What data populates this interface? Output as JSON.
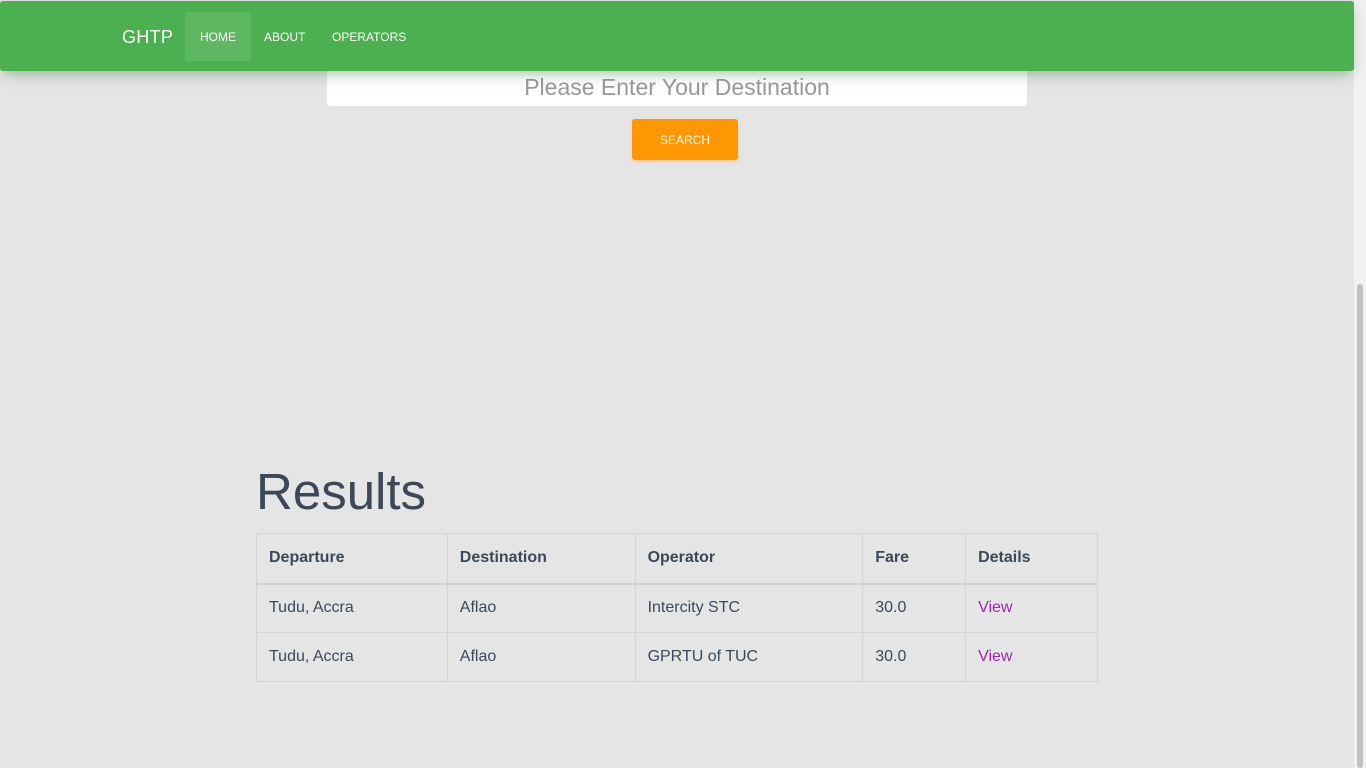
{
  "navbar": {
    "brand": "GHTP",
    "items": [
      {
        "label": "HOME",
        "active": true
      },
      {
        "label": "ABOUT",
        "active": false
      },
      {
        "label": "OPERATORS",
        "active": false
      }
    ]
  },
  "search": {
    "placeholder": "Please Enter Your Destination",
    "value": "",
    "button_label": "SEARCH"
  },
  "results": {
    "title": "Results",
    "columns": [
      "Departure",
      "Destination",
      "Operator",
      "Fare",
      "Details"
    ],
    "rows": [
      {
        "departure": "Tudu, Accra",
        "destination": "Aflao",
        "operator": "Intercity STC",
        "fare": "30.0",
        "details": "View"
      },
      {
        "departure": "Tudu, Accra",
        "destination": "Aflao",
        "operator": "GPRTU of TUC",
        "fare": "30.0",
        "details": "View"
      }
    ]
  },
  "colors": {
    "navbar": "#4caf50",
    "search_button": "#ff9800",
    "link": "#9c27b0",
    "background": "#e5e5e5"
  }
}
